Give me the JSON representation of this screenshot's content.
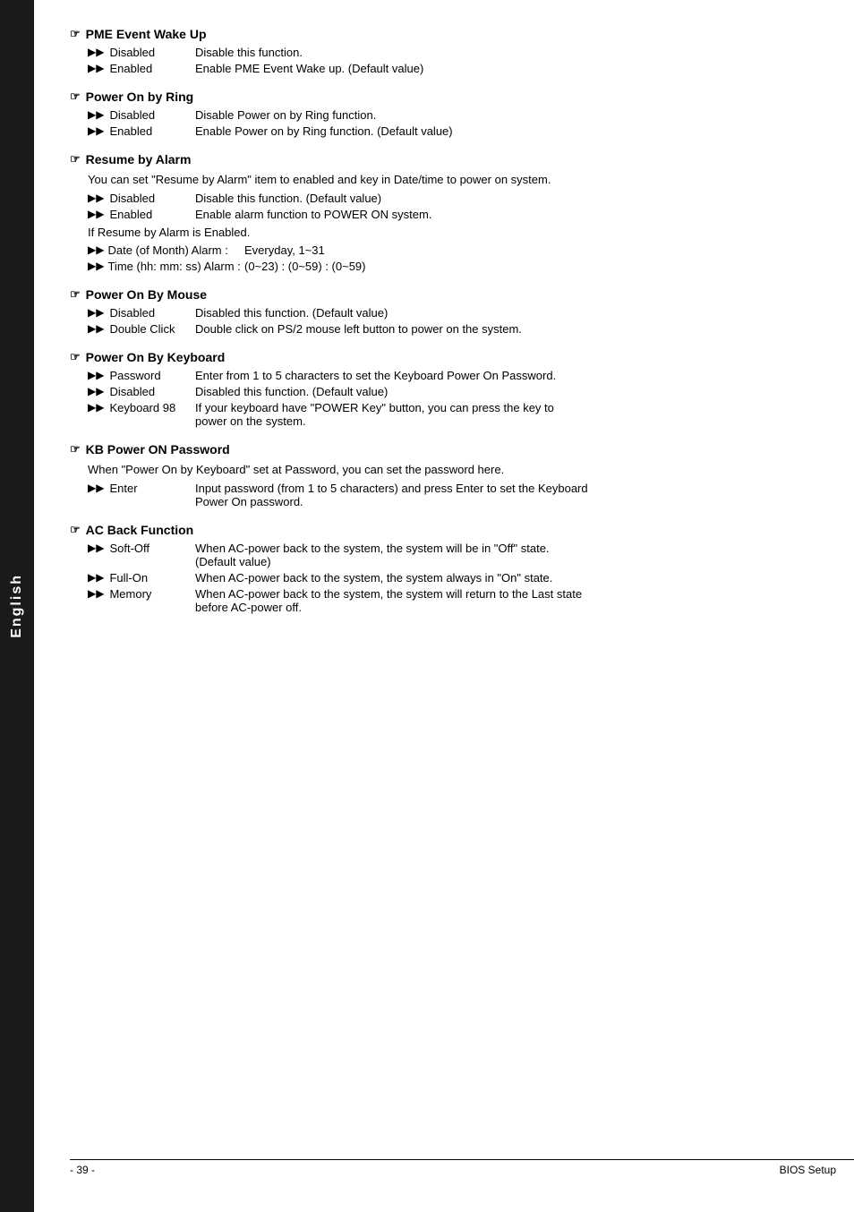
{
  "sidebar": {
    "label": "English"
  },
  "sections": [
    {
      "id": "pme-event-wake-up",
      "title": "PME Event Wake Up",
      "items": [
        {
          "label": "Disabled",
          "desc": "Disable this function."
        },
        {
          "label": "Enabled",
          "desc": "Enable PME Event Wake up. (Default value)"
        }
      ],
      "notes": []
    },
    {
      "id": "power-on-by-ring",
      "title": "Power On by Ring",
      "items": [
        {
          "label": "Disabled",
          "desc": "Disable Power on by Ring function."
        },
        {
          "label": "Enabled",
          "desc": "Enable Power on by Ring function. (Default value)"
        }
      ],
      "notes": []
    },
    {
      "id": "resume-by-alarm",
      "title": "Resume by Alarm",
      "notes": [
        "You can set \"Resume by Alarm\" item to enabled and key in Date/time to power on system."
      ],
      "items": [
        {
          "label": "Disabled",
          "desc": "Disable this function. (Default value)"
        },
        {
          "label": "Enabled",
          "desc": "Enable alarm function to POWER ON system."
        }
      ],
      "extra_notes": [
        "If Resume by Alarm is Enabled."
      ],
      "extra_items": [
        {
          "label": "Date (of Month) Alarm :",
          "desc": "Everyday, 1~31"
        },
        {
          "label": "Time (hh: mm: ss) Alarm :",
          "desc": "(0~23) : (0~59) : (0~59)"
        }
      ]
    },
    {
      "id": "power-on-by-mouse",
      "title": "Power On By Mouse",
      "items": [
        {
          "label": "Disabled",
          "desc": "Disabled this function. (Default value)"
        },
        {
          "label": "Double Click",
          "desc": "Double click on PS/2 mouse left button to power on the system."
        }
      ],
      "notes": []
    },
    {
      "id": "power-on-by-keyboard",
      "title": "Power On By Keyboard",
      "items": [
        {
          "label": "Password",
          "desc": "Enter from 1 to 5 characters to set the Keyboard Power On Password."
        },
        {
          "label": "Disabled",
          "desc": "Disabled this function. (Default value)"
        },
        {
          "label": "Keyboard 98",
          "desc": "If your keyboard have \"POWER Key\" button, you can press the key to\npower on the system."
        }
      ],
      "notes": []
    },
    {
      "id": "kb-power-on-password",
      "title": "KB Power ON Password",
      "notes": [
        "When \"Power On by Keyboard\" set at Password, you can set the password here."
      ],
      "items": [
        {
          "label": "Enter",
          "desc": "Input password (from 1 to 5 characters) and press Enter to set the Keyboard\nPower On password."
        }
      ]
    },
    {
      "id": "ac-back-function",
      "title": "AC Back Function",
      "items": [
        {
          "label": "Soft-Off",
          "desc": "When AC-power back to the system, the system will be in \"Off\" state.\n(Default value)"
        },
        {
          "label": "Full-On",
          "desc": "When AC-power back to the system, the system always in \"On\" state."
        },
        {
          "label": "Memory",
          "desc": "When AC-power back to the system, the system will return to the Last state\nbefore AC-power off."
        }
      ],
      "notes": []
    }
  ],
  "footer": {
    "page": "- 39 -",
    "label": "BIOS Setup"
  }
}
